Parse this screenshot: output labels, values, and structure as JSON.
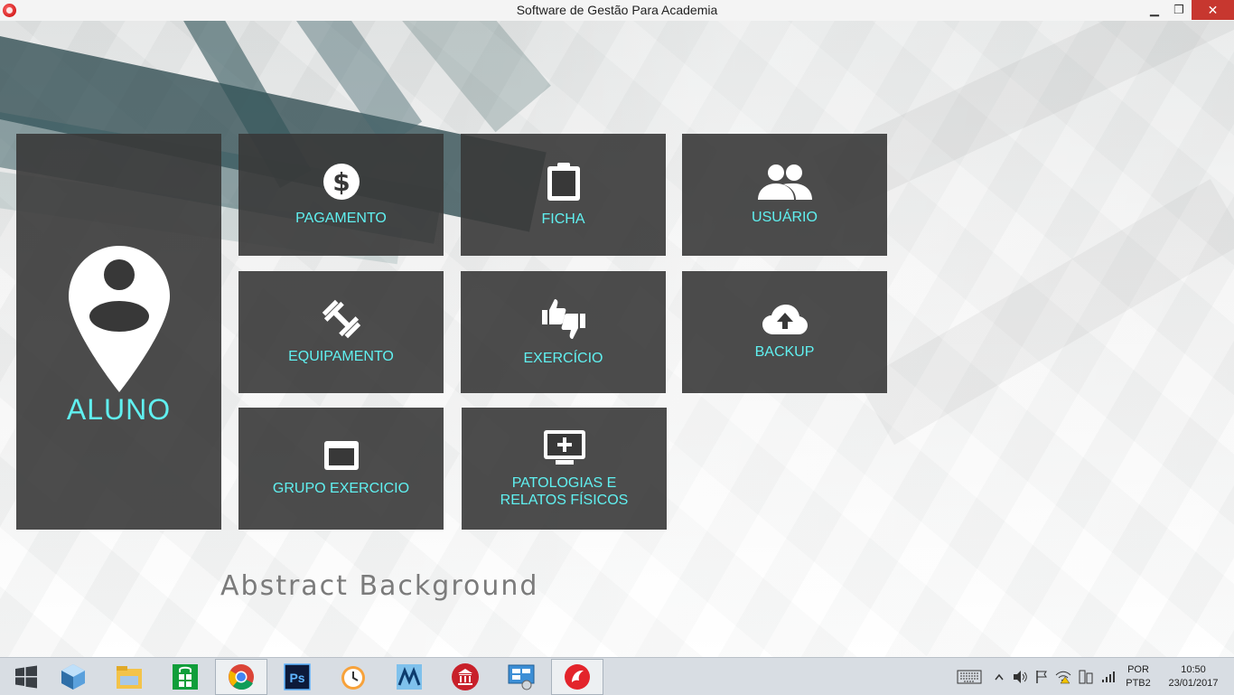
{
  "window": {
    "title": "Software de Gestão Para Academia",
    "minimize": "▁",
    "restore": "❐",
    "close": "✕"
  },
  "background": {
    "caption": "Abstract Background"
  },
  "tiles": {
    "aluno": {
      "label": "ALUNO",
      "icon": "map-pin-person-icon"
    },
    "pagamento": {
      "label": "PAGAMENTO",
      "icon": "dollar-coin-icon"
    },
    "ficha": {
      "label": "FICHA",
      "icon": "clipboard-icon"
    },
    "usuario": {
      "label": "USUÁRIO",
      "icon": "users-icon"
    },
    "equipamento": {
      "label": "EQUIPAMENTO",
      "icon": "dumbbell-icon"
    },
    "exercicio": {
      "label": "EXERCÍCIO",
      "icon": "thumbs-up-down-icon"
    },
    "backup": {
      "label": "BACKUP",
      "icon": "cloud-upload-icon"
    },
    "grupo_exercicio": {
      "label": "GRUPO EXERCICIO",
      "icon": "window-icon"
    },
    "patologias": {
      "label": "PATOLOGIAS E\nRELATOS FÍSICOS",
      "icon": "monitor-plus-icon"
    }
  },
  "taskbar": {
    "apps": [
      "start-icon",
      "virtualbox-icon",
      "file-explorer-icon",
      "store-icon",
      "chrome-icon",
      "photoshop-icon",
      "clock-app-icon",
      "maxima-icon",
      "bank-app-icon",
      "network-app-icon",
      "academia-app-icon"
    ],
    "language": "POR",
    "keyboard": "PTB2",
    "time": "10:50",
    "date": "23/01/2017"
  },
  "colors": {
    "tile_bg": "#383838",
    "accent_cyan": "#60f0f0",
    "close_red": "#c7372f"
  }
}
